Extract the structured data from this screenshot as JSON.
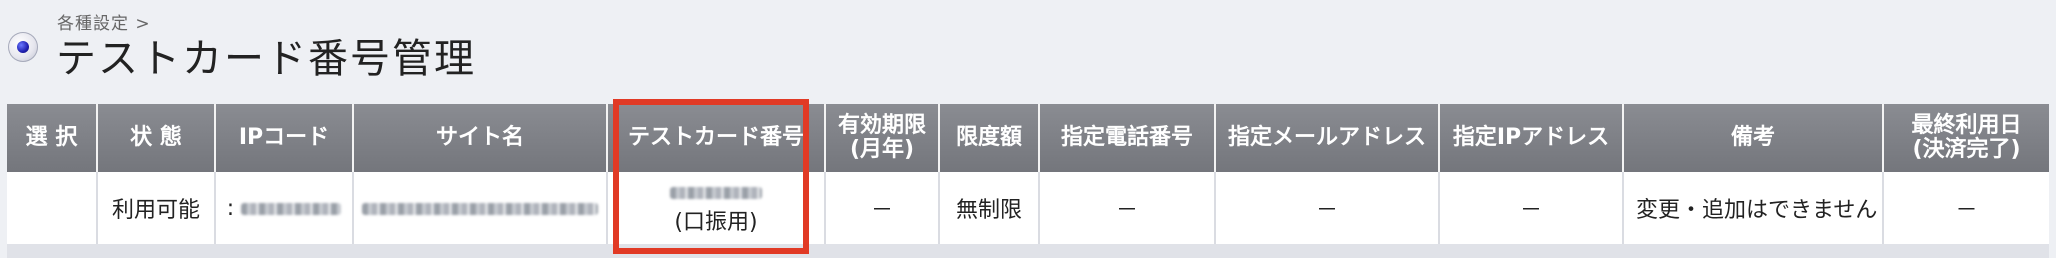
{
  "breadcrumb": "各種設定 >",
  "page_title": "テストカード番号管理",
  "table": {
    "headers": [
      "選 択",
      "状 態",
      "IPコード",
      "サイト名",
      "テストカード番号",
      "有効期限\n(月年)",
      "限度額",
      "指定電話番号",
      "指定メールアドレス",
      "指定IPアドレス",
      "備考",
      "最終利用日\n(決済完了)"
    ],
    "row": {
      "select": "",
      "status": "利用可能",
      "ip_code_prefix": ":",
      "testcard_note": "(口振用)",
      "expiry": "－",
      "limit": "無制限",
      "phone": "－",
      "email": "－",
      "ip": "－",
      "remarks": "変更・追加はできません",
      "last_used": "－"
    }
  },
  "colors": {
    "header_bg": "#7f8187",
    "highlight": "#e13a25",
    "page_bg": "#eef0f4"
  }
}
